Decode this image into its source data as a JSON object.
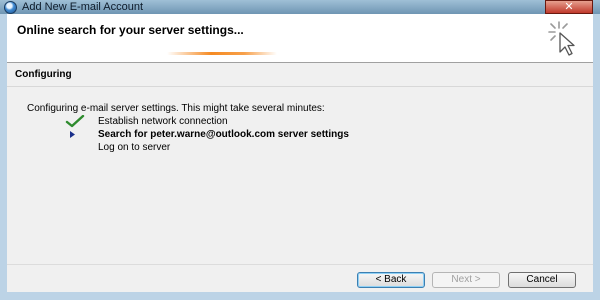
{
  "window": {
    "title": "Add New E-mail Account",
    "close_glyph": "✕"
  },
  "header": {
    "title": "Online search for your server settings..."
  },
  "section": {
    "title": "Configuring"
  },
  "status_text": "Configuring e-mail server settings. This might take several minutes:",
  "steps": [
    {
      "label": "Establish network connection",
      "state": "done",
      "icon": "checkmark-icon"
    },
    {
      "label": "Search for peter.warne@outlook.com server settings",
      "state": "current",
      "icon": "arrow-right-icon"
    },
    {
      "label": "Log on to server",
      "state": "pending",
      "icon": ""
    }
  ],
  "buttons": {
    "back": "< Back",
    "next": "Next >",
    "cancel": "Cancel"
  },
  "colors": {
    "check": "#2e8b2e",
    "arrow": "#1a2f8a",
    "progress": "#f58a22"
  }
}
